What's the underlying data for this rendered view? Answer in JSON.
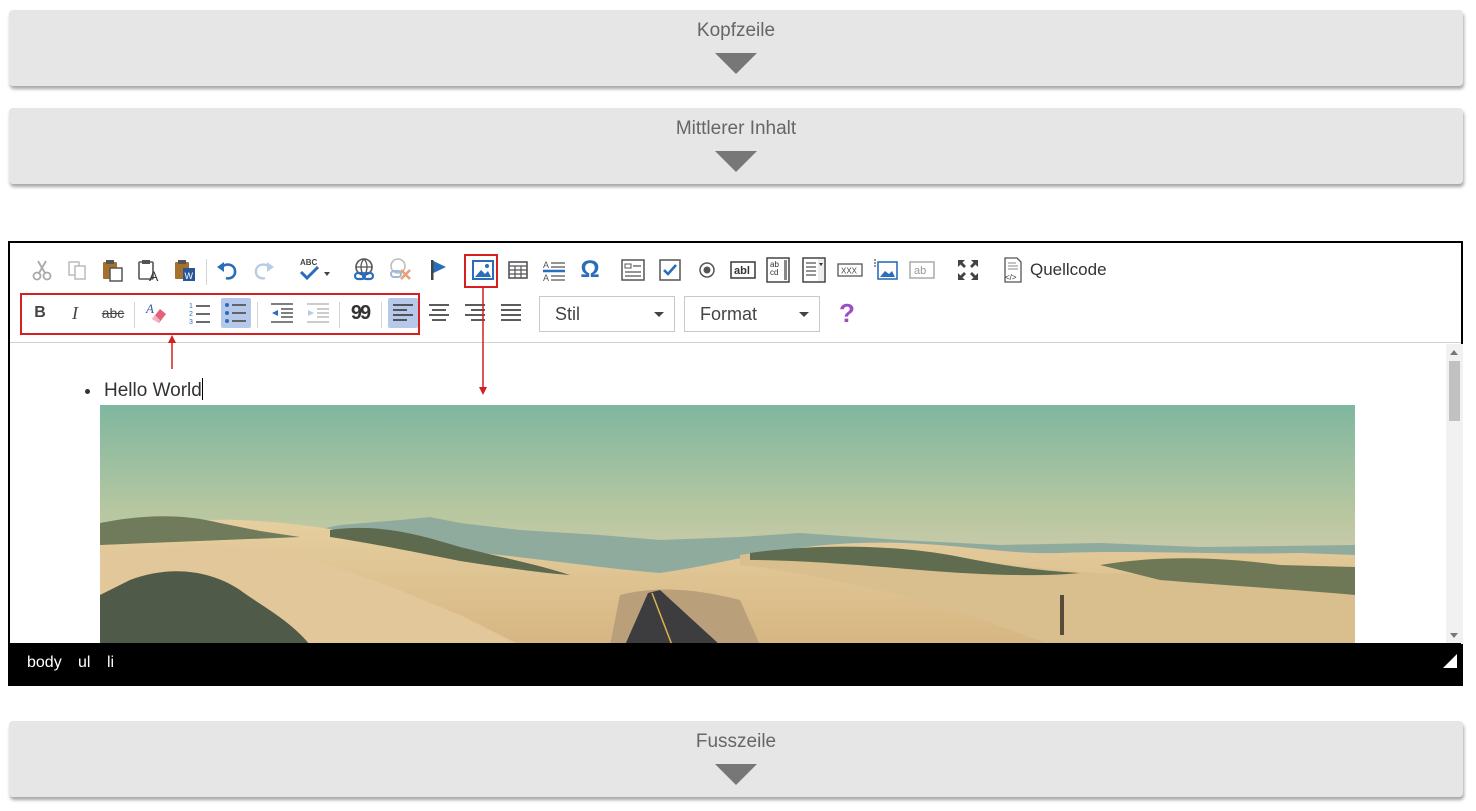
{
  "sections": {
    "header_label": "Kopfzeile",
    "middle_label": "Mittlerer Inhalt",
    "footer_label": "Fusszeile"
  },
  "toolbar": {
    "row1_icons": [
      "cut-icon",
      "copy-icon",
      "paste-icon",
      "paste-text-icon",
      "paste-word-icon",
      "undo-icon",
      "redo-icon",
      "spellcheck-icon",
      "link-icon",
      "unlink-icon",
      "anchor-icon",
      "image-icon",
      "table-icon",
      "horizontal-rule-icon",
      "special-char-icon",
      "form-icon",
      "checkbox-icon",
      "radio-icon",
      "textfield-icon",
      "textarea-icon",
      "select-icon",
      "button-icon",
      "image-button-icon",
      "hidden-field-icon",
      "maximize-icon",
      "source-icon"
    ],
    "source_label": "Quellcode",
    "special_char_glyph": "Ω",
    "row2_icons": [
      "bold-icon",
      "italic-icon",
      "strikethrough-icon",
      "remove-format-icon",
      "numbered-list-icon",
      "bulleted-list-icon",
      "outdent-icon",
      "indent-icon",
      "blockquote-icon",
      "align-left-icon",
      "align-center-icon",
      "align-right-icon",
      "justify-icon"
    ],
    "bold_glyph": "B",
    "italic_glyph": "I",
    "strike_glyph": "abc",
    "quote_glyph": "99",
    "help_glyph": "?",
    "style_dropdown": "Stil",
    "format_dropdown": "Format"
  },
  "editor": {
    "list_item": "Hello World"
  },
  "statusbar": {
    "path": [
      "body",
      "ul",
      "li"
    ]
  },
  "colors": {
    "highlight_box": "#d42020",
    "active_button": "#b6c9ea",
    "help_icon": "#9c4fc5",
    "accent_blue": "#2a6ebb"
  }
}
